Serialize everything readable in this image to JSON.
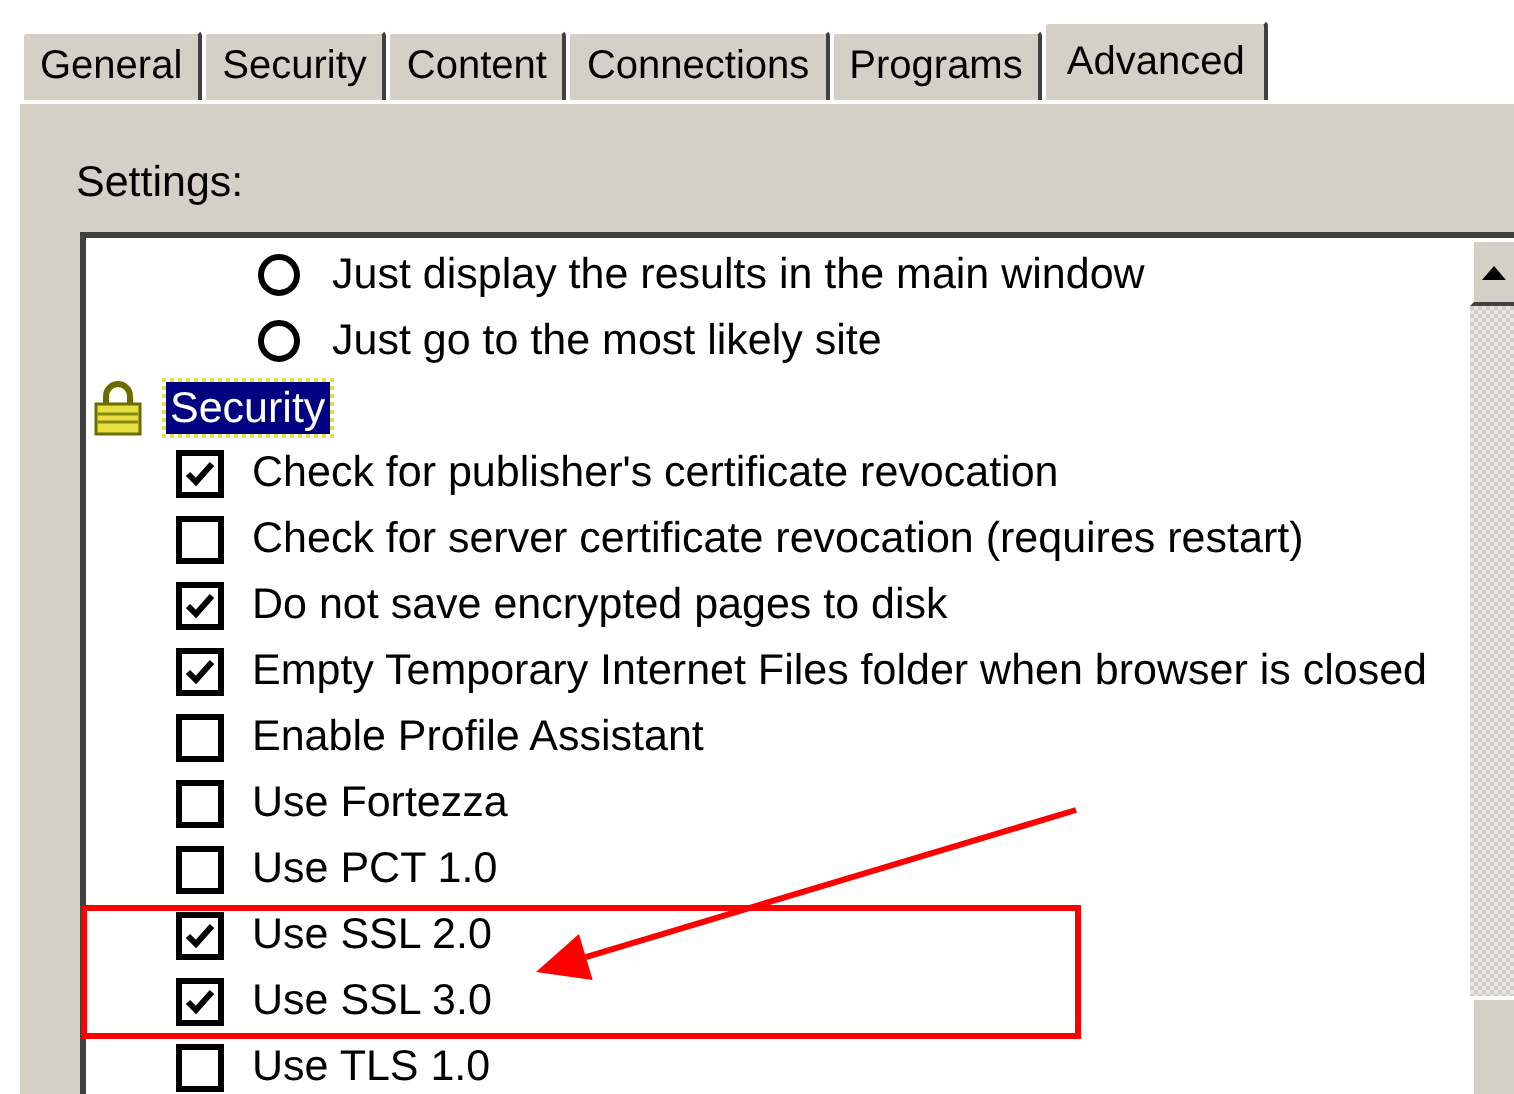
{
  "tabs": [
    {
      "label": "General",
      "selected": false
    },
    {
      "label": "Security",
      "selected": false
    },
    {
      "label": "Content",
      "selected": false
    },
    {
      "label": "Connections",
      "selected": false
    },
    {
      "label": "Programs",
      "selected": false
    },
    {
      "label": "Advanced",
      "selected": true
    }
  ],
  "settings_label": "Settings:",
  "settings_tree": [
    {
      "kind": "radio",
      "label": "Just display the results in the main window",
      "selected": false
    },
    {
      "kind": "radio",
      "label": "Just go to the most likely site",
      "selected": false
    },
    {
      "kind": "category",
      "label": "Security",
      "selected": true,
      "children": [
        {
          "kind": "checkbox",
          "label": "Check for publisher's certificate revocation",
          "checked": true
        },
        {
          "kind": "checkbox",
          "label": "Check for server certificate revocation (requires restart)",
          "checked": false
        },
        {
          "kind": "checkbox",
          "label": "Do not save encrypted pages to disk",
          "checked": true
        },
        {
          "kind": "checkbox",
          "label": "Empty Temporary Internet Files folder when browser is closed",
          "checked": true
        },
        {
          "kind": "checkbox",
          "label": "Enable Profile Assistant",
          "checked": false
        },
        {
          "kind": "checkbox",
          "label": "Use Fortezza",
          "checked": false
        },
        {
          "kind": "checkbox",
          "label": "Use PCT 1.0",
          "checked": false
        },
        {
          "kind": "checkbox",
          "label": "Use SSL 2.0",
          "checked": true
        },
        {
          "kind": "checkbox",
          "label": "Use SSL 3.0",
          "checked": true
        },
        {
          "kind": "checkbox",
          "label": "Use TLS 1.0",
          "checked": false
        }
      ]
    }
  ],
  "annotations": [
    {
      "kind": "box"
    },
    {
      "kind": "arrow"
    }
  ]
}
